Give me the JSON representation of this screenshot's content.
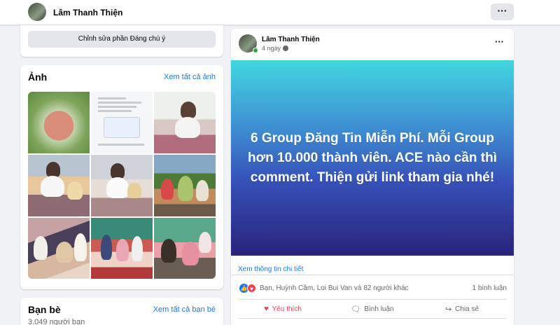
{
  "header": {
    "profile_name": "Lâm Thanh Thiện",
    "more_label": "···"
  },
  "featured": {
    "edit_label": "Chỉnh sửa phần Đáng chú ý"
  },
  "photos": {
    "title": "Ảnh",
    "see_all": "Xem tất cả ảnh",
    "count": 9
  },
  "friends": {
    "title": "Bạn bè",
    "see_all": "Xem tất cả bạn bè",
    "count_text": "3.049 người bạn"
  },
  "post": {
    "author": "Lâm Thanh Thiện",
    "time": "4 ngày",
    "more_label": "···",
    "text": "6 Group Đăng Tin Miễn Phí. Mỗi Group hơn 10.000 thành viên. ACE nào cần thì comment. Thiện gửi link tham gia nhé!",
    "see_details": "Xem thông tin chi tiết",
    "reactions_text": "Bạn, Huỳnh Cầm, Loi Bui Van và 82 người khác",
    "comments_text": "1 bình luận",
    "actions": {
      "like": "Yêu thích",
      "comment": "Bình luận",
      "share": "Chia sẻ"
    }
  },
  "icons": {
    "like": "thumbs-up-icon",
    "love": "heart-icon",
    "comment": "speech-bubble-icon",
    "share": "share-arrow-icon",
    "globe": "globe-icon"
  },
  "colors": {
    "accent": "#1877f2",
    "love": "#f33e58",
    "online": "#31a24c"
  }
}
